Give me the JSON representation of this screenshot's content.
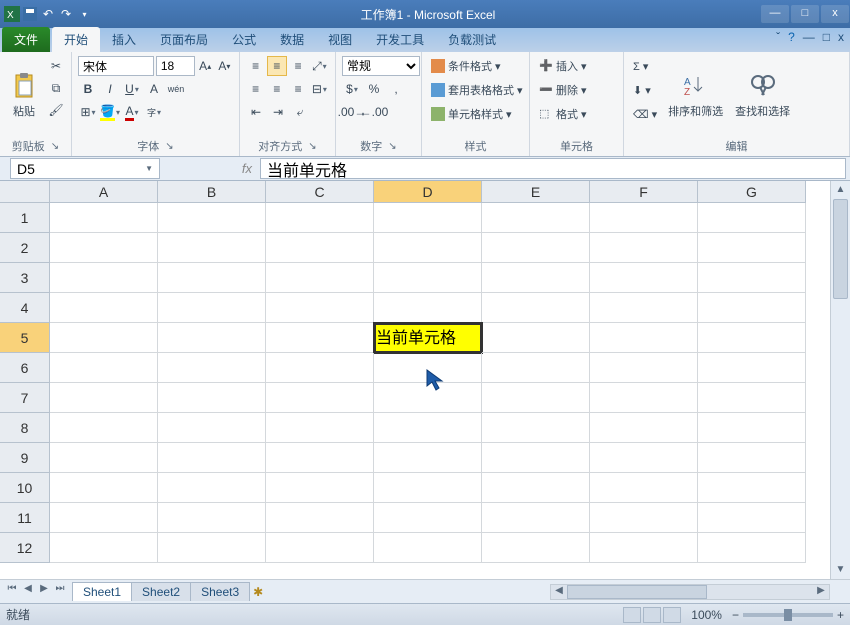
{
  "title": "工作簿1 - Microsoft Excel",
  "tabs": {
    "file": "文件",
    "home": "开始",
    "insert": "插入",
    "pagelayout": "页面布局",
    "formulas": "公式",
    "data": "数据",
    "view": "视图",
    "dev": "开发工具",
    "load": "负载测试"
  },
  "ribbon": {
    "clipboard": {
      "paste": "粘贴",
      "label": "剪贴板"
    },
    "font": {
      "name": "宋体",
      "size": "18",
      "label": "字体"
    },
    "align": {
      "label": "对齐方式"
    },
    "number": {
      "format": "常规",
      "label": "数字"
    },
    "styles": {
      "cond": "条件格式",
      "table": "套用表格格式",
      "cell": "单元格样式",
      "label": "样式"
    },
    "cells": {
      "insert": "插入",
      "delete": "删除",
      "format": "格式",
      "label": "单元格"
    },
    "editing": {
      "sort": "排序和筛选",
      "find": "查找和选择",
      "label": "编辑"
    }
  },
  "namebox": "D5",
  "formula": "当前单元格",
  "columns": [
    "A",
    "B",
    "C",
    "D",
    "E",
    "F",
    "G"
  ],
  "rows": [
    "1",
    "2",
    "3",
    "4",
    "5",
    "6",
    "7",
    "8",
    "9",
    "10",
    "11",
    "12"
  ],
  "active": {
    "col": 3,
    "row": 4,
    "value": "当前单元格"
  },
  "sheets": [
    "Sheet1",
    "Sheet2",
    "Sheet3"
  ],
  "status": {
    "ready": "就绪",
    "zoom": "100%"
  }
}
